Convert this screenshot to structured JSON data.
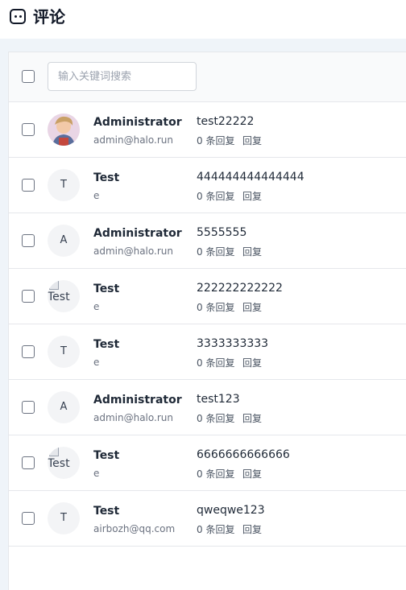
{
  "header": {
    "title": "评论",
    "icon": "chat-bubble-icon"
  },
  "toolbar": {
    "search_placeholder": "输入关键词搜索"
  },
  "comments": [
    {
      "author": "Administrator",
      "email": "admin@halo.run",
      "avatar": "image",
      "content": "test22222",
      "reply_count": "0 条回复",
      "reply_action": "回复"
    },
    {
      "author": "Test",
      "email": "e",
      "avatar": "T",
      "content": "444444444444444",
      "reply_count": "0 条回复",
      "reply_action": "回复"
    },
    {
      "author": "Administrator",
      "email": "admin@halo.run",
      "avatar": "A",
      "content": "5555555",
      "reply_count": "0 条回复",
      "reply_action": "回复"
    },
    {
      "author": "Test",
      "email": "e",
      "avatar": "Test",
      "content": "222222222222",
      "reply_count": "0 条回复",
      "reply_action": "回复"
    },
    {
      "author": "Test",
      "email": "e",
      "avatar": "T",
      "content": "3333333333",
      "reply_count": "0 条回复",
      "reply_action": "回复"
    },
    {
      "author": "Administrator",
      "email": "admin@halo.run",
      "avatar": "A",
      "content": "test123",
      "reply_count": "0 条回复",
      "reply_action": "回复"
    },
    {
      "author": "Test",
      "email": "e",
      "avatar": "Test",
      "content": "6666666666666",
      "reply_count": "0 条回复",
      "reply_action": "回复"
    },
    {
      "author": "Test",
      "email": "airbozh@qq.com",
      "avatar": "T",
      "content": "qweqwe123",
      "reply_count": "0 条回复",
      "reply_action": "回复"
    }
  ]
}
